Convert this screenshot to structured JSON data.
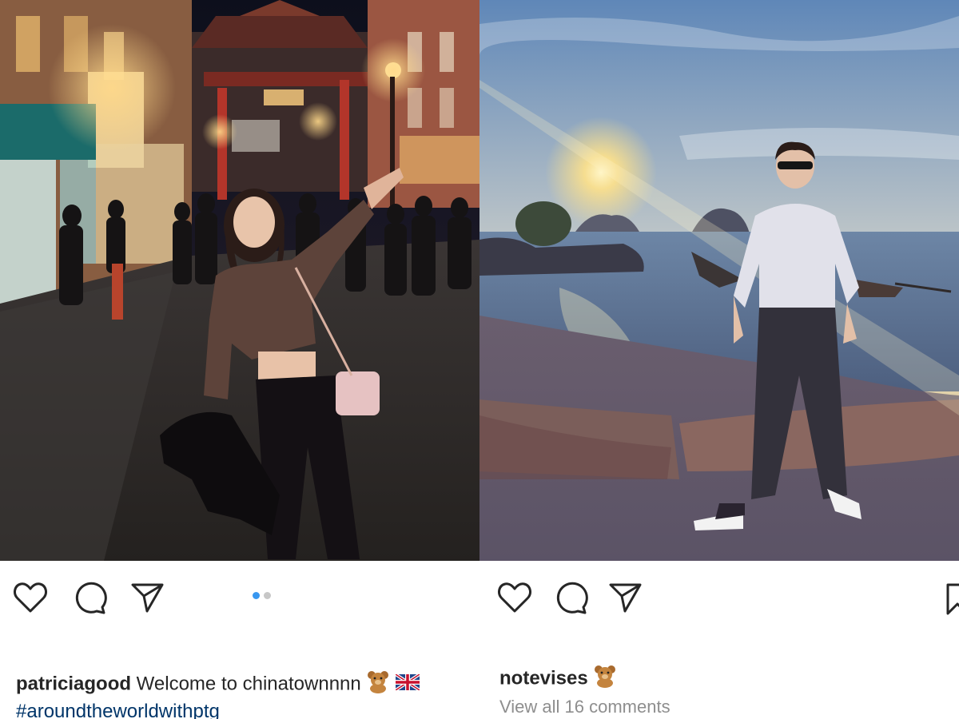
{
  "posts": [
    {
      "username": "patriciagood",
      "caption_text": " Welcome to chinatownnnn ",
      "emoji_bear": "teddy-bear",
      "emoji_flag": "uk-flag",
      "hashtag": "#aroundtheworldwithptg",
      "carousel": {
        "total": 2,
        "current": 1
      },
      "actions": {
        "like": "heart-icon",
        "comment": "comment-icon",
        "share": "send-icon"
      }
    },
    {
      "username": "notevises",
      "emoji_bear": "teddy-bear",
      "comments_link": "View all 16 comments",
      "actions": {
        "like": "heart-icon",
        "comment": "comment-icon",
        "share": "send-icon",
        "save": "bookmark-icon"
      }
    }
  ],
  "colors": {
    "text": "#262626",
    "muted": "#8e8e8e",
    "hashtag": "#003569",
    "carousel_active": "#3897f0",
    "carousel_inactive": "#c7c7c7"
  }
}
